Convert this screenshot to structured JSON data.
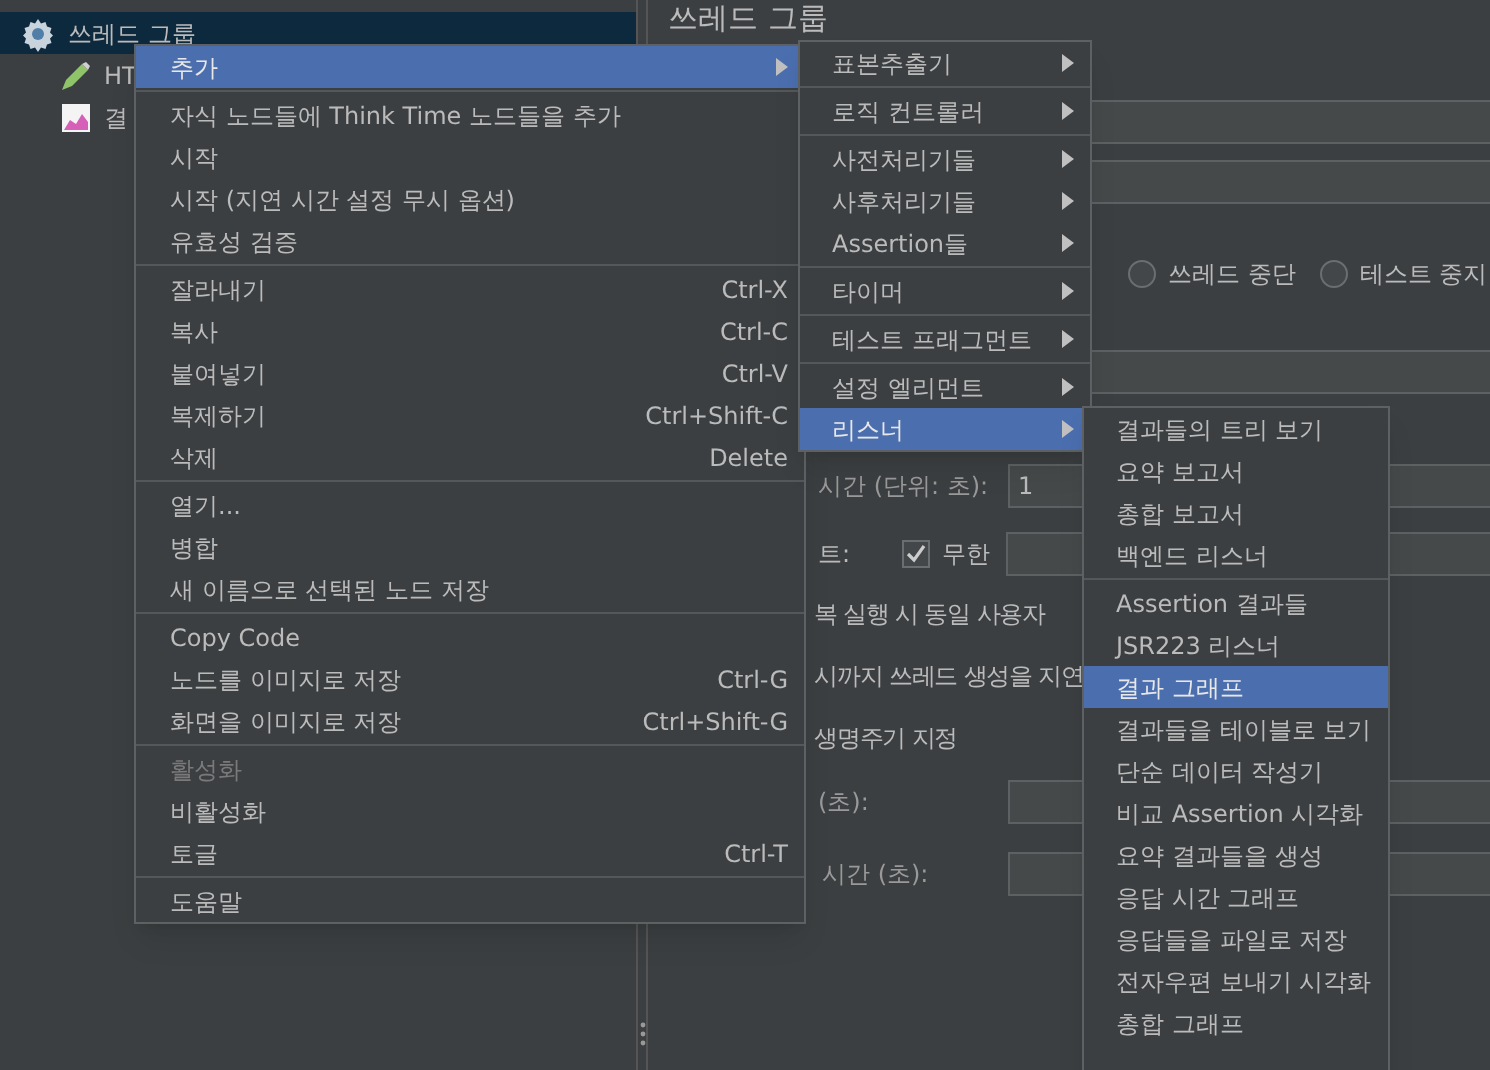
{
  "tree": {
    "items": [
      {
        "label": "쓰레드 그룹",
        "kind": "threadgroup",
        "selected": true,
        "children": [
          {
            "label": "HT",
            "kind": "sampler",
            "selected": false
          },
          {
            "label": "결",
            "kind": "listener",
            "selected": false
          }
        ]
      }
    ]
  },
  "panel": {
    "title": "쓰레드 그룹",
    "radios": [
      {
        "label": "쓰레드 중단",
        "selected": false
      },
      {
        "label": "테스트 중지",
        "selected": false
      }
    ],
    "duration_label": "시간 (단위: 초):",
    "duration_value": "1",
    "loop_label": "트:",
    "infinite": {
      "label": "무한",
      "checked": true
    },
    "lines": [
      "복 실행 시 동일 사용자",
      "시까지 쓰레드 생성을 지연",
      "생명주기 지정"
    ],
    "delay_label": "(초):",
    "startup_label": "시간 (초):"
  },
  "context_menu": {
    "items": [
      {
        "kind": "item",
        "label": "추가",
        "submenu": true,
        "selected": true
      },
      {
        "kind": "separator"
      },
      {
        "kind": "item",
        "label": "자식 노드들에 Think Time 노드들을 추가"
      },
      {
        "kind": "item",
        "label": "시작"
      },
      {
        "kind": "item",
        "label": "시작 (지연 시간 설정 무시 옵션)"
      },
      {
        "kind": "item",
        "label": "유효성 검증"
      },
      {
        "kind": "separator"
      },
      {
        "kind": "item",
        "label": "잘라내기",
        "shortcut": "Ctrl-X"
      },
      {
        "kind": "item",
        "label": "복사",
        "shortcut": "Ctrl-C"
      },
      {
        "kind": "item",
        "label": "붙여넣기",
        "shortcut": "Ctrl-V"
      },
      {
        "kind": "item",
        "label": "복제하기",
        "shortcut": "Ctrl+Shift-C"
      },
      {
        "kind": "item",
        "label": "삭제",
        "shortcut": "Delete"
      },
      {
        "kind": "separator"
      },
      {
        "kind": "item",
        "label": "열기..."
      },
      {
        "kind": "item",
        "label": "병합"
      },
      {
        "kind": "item",
        "label": "새 이름으로 선택된 노드 저장"
      },
      {
        "kind": "separator"
      },
      {
        "kind": "item",
        "label": "Copy Code"
      },
      {
        "kind": "item",
        "label": "노드를 이미지로 저장",
        "shortcut": "Ctrl-G"
      },
      {
        "kind": "item",
        "label": "화면을 이미지로 저장",
        "shortcut": "Ctrl+Shift-G"
      },
      {
        "kind": "separator"
      },
      {
        "kind": "item",
        "label": "활성화",
        "disabled": true
      },
      {
        "kind": "item",
        "label": "비활성화"
      },
      {
        "kind": "item",
        "label": "토글",
        "shortcut": "Ctrl-T"
      },
      {
        "kind": "separator"
      },
      {
        "kind": "item",
        "label": "도움말"
      }
    ]
  },
  "add_submenu": {
    "items": [
      {
        "kind": "item",
        "label": "표본추출기",
        "submenu": true,
        "selected": false
      },
      {
        "kind": "separator"
      },
      {
        "kind": "item",
        "label": "로직 컨트롤러",
        "submenu": true,
        "selected": false
      },
      {
        "kind": "separator"
      },
      {
        "kind": "item",
        "label": "사전처리기들",
        "submenu": true,
        "selected": false
      },
      {
        "kind": "item",
        "label": "사후처리기들",
        "submenu": true,
        "selected": false
      },
      {
        "kind": "item",
        "label": "Assertion들",
        "submenu": true,
        "selected": false
      },
      {
        "kind": "separator"
      },
      {
        "kind": "item",
        "label": "타이머",
        "submenu": true,
        "selected": false
      },
      {
        "kind": "separator"
      },
      {
        "kind": "item",
        "label": "테스트 프래그먼트",
        "submenu": true,
        "selected": false
      },
      {
        "kind": "separator"
      },
      {
        "kind": "item",
        "label": "설정 엘리먼트",
        "submenu": true,
        "selected": false
      },
      {
        "kind": "item",
        "label": "리스너",
        "submenu": true,
        "selected": true
      }
    ]
  },
  "listener_submenu": {
    "items": [
      {
        "kind": "item",
        "label": "결과들의 트리 보기",
        "selected": false
      },
      {
        "kind": "item",
        "label": "요약 보고서",
        "selected": false
      },
      {
        "kind": "item",
        "label": "총합 보고서",
        "selected": false
      },
      {
        "kind": "item",
        "label": "백엔드 리스너",
        "selected": false
      },
      {
        "kind": "separator"
      },
      {
        "kind": "item",
        "label": "Assertion 결과들",
        "selected": false
      },
      {
        "kind": "item",
        "label": "JSR223 리스너",
        "selected": false
      },
      {
        "kind": "item",
        "label": "결과 그래프",
        "selected": true
      },
      {
        "kind": "item",
        "label": "결과들을 테이블로 보기",
        "selected": false
      },
      {
        "kind": "item",
        "label": "단순 데이터 작성기",
        "selected": false
      },
      {
        "kind": "item",
        "label": "비교 Assertion 시각화",
        "selected": false
      },
      {
        "kind": "item",
        "label": "요약 결과들을 생성",
        "selected": false
      },
      {
        "kind": "item",
        "label": "응답 시간 그래프",
        "selected": false
      },
      {
        "kind": "item",
        "label": "응답들을 파일로 저장",
        "selected": false
      },
      {
        "kind": "item",
        "label": "전자우편 보내기 시각화",
        "selected": false
      },
      {
        "kind": "item",
        "label": "총합 그래프",
        "selected": false
      }
    ]
  }
}
